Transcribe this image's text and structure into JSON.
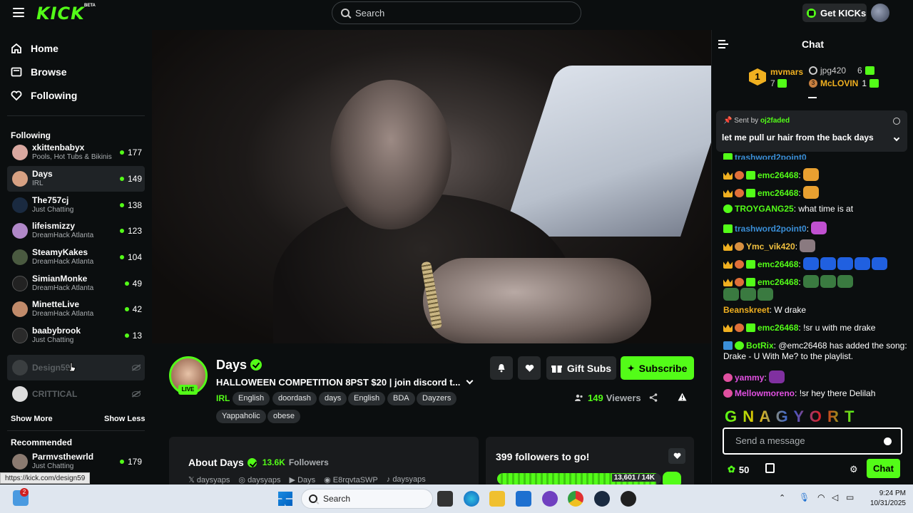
{
  "app": {
    "logo": "KICK",
    "logo_badge": "BETA",
    "search_placeholder": "Search",
    "get_kicks": "Get KICKs"
  },
  "nav": {
    "home": "Home",
    "browse": "Browse",
    "following": "Following"
  },
  "sidebar": {
    "following_title": "Following",
    "channels": [
      {
        "name": "xkittenbabyx",
        "category": "Pools, Hot Tubs & Bikinis",
        "viewers": "177",
        "color": "#d9a8a0"
      },
      {
        "name": "Days",
        "category": "IRL",
        "viewers": "149",
        "color": "#d7a183"
      },
      {
        "name": "The757cj",
        "category": "Just Chatting",
        "viewers": "138",
        "color": "#1a2a40"
      },
      {
        "name": "lifeismizzy",
        "category": "DreamHack Atlanta",
        "viewers": "123",
        "color": "#b088c8"
      },
      {
        "name": "SteamyKakes",
        "category": "DreamHack Atlanta",
        "viewers": "104",
        "color": "#4a5a40"
      },
      {
        "name": "SimianMonke",
        "category": "DreamHack Atlanta",
        "viewers": "49",
        "color": "#222"
      },
      {
        "name": "MinetteLive",
        "category": "DreamHack Atlanta",
        "viewers": "42",
        "color": "#c08a6a"
      },
      {
        "name": "baabybrook",
        "category": "Just Chatting",
        "viewers": "13",
        "color": "#2a2a2a"
      }
    ],
    "offline": [
      {
        "name": "Design59"
      },
      {
        "name": "CRITTICAL"
      }
    ],
    "show_more": "Show More",
    "show_less": "Show Less",
    "recommended_title": "Recommended",
    "recommended": [
      {
        "name": "Parmvsthewrld",
        "category": "Just Chatting",
        "viewers": "179"
      }
    ]
  },
  "stream": {
    "streamer": "Days",
    "live_label": "LIVE",
    "title": "HALLOWEEN COMPETITION 8PST $20  | join discord t...",
    "category": "IRL",
    "tags": [
      "English",
      "doordash",
      "days",
      "English",
      "BDA",
      "Dayzers",
      "Yappaholic",
      "obese"
    ],
    "gift_subs": "Gift Subs",
    "subscribe": "Subscribe",
    "viewers": "149",
    "viewers_label": "Viewers"
  },
  "about": {
    "title": "About Days",
    "followers": "13.6K",
    "followers_label": "Followers",
    "socials": [
      "daysyaps",
      "daysyaps",
      "Days",
      "E8rqvtaSWP",
      "daysyaps"
    ]
  },
  "goal": {
    "title": "399 followers to go!",
    "progress_text": "13,601 / 14K",
    "progress_fraction": 0.9715
  },
  "chat": {
    "title": "Chat",
    "leaderboard": [
      {
        "rank": "1",
        "name": "mvmars",
        "count": "7"
      },
      {
        "rank": "",
        "name": "jpg420",
        "count": "6"
      },
      {
        "rank": "3",
        "name": "McLOVIN",
        "count": "1"
      }
    ],
    "pinned": {
      "sent_by_label": "Sent by",
      "sent_by": "oj2faded",
      "text": "let me pull ur hair from the back days"
    },
    "messages": [
      {
        "user": "trashword2point0",
        "color": "#3a8fd8",
        "text": ""
      },
      {
        "user": "emc26468",
        "color": "#53fc18",
        "text": ""
      },
      {
        "user": "emc26468",
        "color": "#53fc18",
        "text": ""
      },
      {
        "user": "TROYGANG25",
        "color": "#53fc18",
        "text": "what time is at"
      },
      {
        "user": "trashword2point0",
        "color": "#3a8fd8",
        "text": ""
      },
      {
        "user": "Ymc_vik420",
        "color": "#f0c040",
        "text": ""
      },
      {
        "user": "emc26468",
        "color": "#53fc18",
        "text": ""
      },
      {
        "user": "emc26468",
        "color": "#53fc18",
        "text": ""
      },
      {
        "user": "Beanskreet",
        "color": "#f0b020",
        "text": "W drake"
      },
      {
        "user": "emc26468",
        "color": "#53fc18",
        "text": "!sr u with me drake"
      },
      {
        "user": "BotRix",
        "color": "#53fc18",
        "text": "@emc26468 has added the song: Drake - U With Me? to the playlist."
      },
      {
        "user": "yammy",
        "color": "#e050e0",
        "text": ""
      },
      {
        "user": "Mellowmoreno",
        "color": "#e050e0",
        "text": "!sr hey there Delilah"
      }
    ],
    "banner_letters": "G N A G Y O R T",
    "input_placeholder": "Send a message",
    "points": "50",
    "send_label": "Chat"
  },
  "status_url": "https://kick.com/design59",
  "taskbar": {
    "search": "Search",
    "notif_count": "2",
    "time": "9:24 PM",
    "date": "10/31/2025"
  },
  "colors": {
    "accent": "#53fc18",
    "background": "#0b0e0f"
  }
}
